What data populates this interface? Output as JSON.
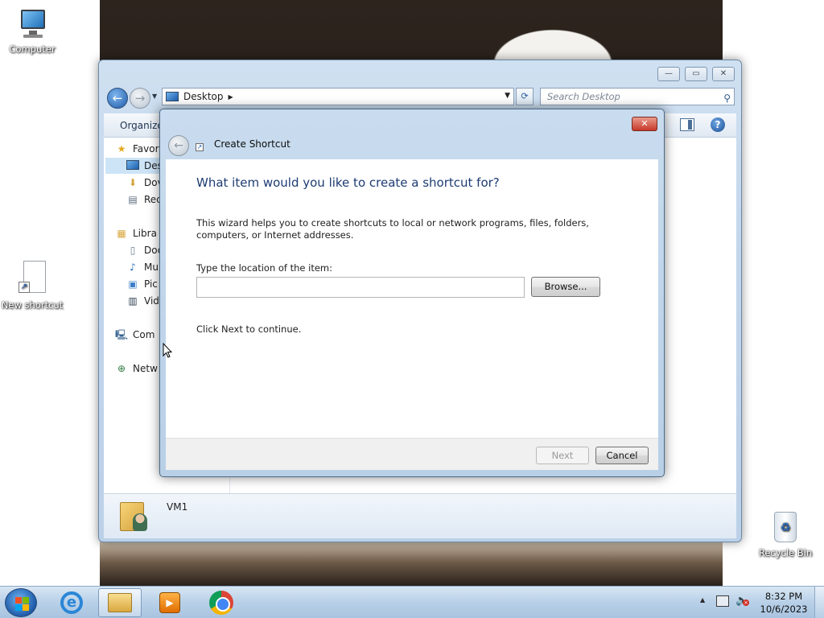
{
  "desktop": {
    "icons": [
      {
        "label": "Computer"
      },
      {
        "label": "New shortcut"
      },
      {
        "label": "Recycle Bin"
      }
    ]
  },
  "explorer": {
    "address": "Desktop",
    "search_placeholder": "Search Desktop",
    "command_bar": {
      "organize": "Organize"
    },
    "nav_items": [
      {
        "label": "Favor",
        "icon": "star-icon",
        "selected": false
      },
      {
        "label": "Des",
        "icon": "desktop-icon",
        "selected": true
      },
      {
        "label": "Dov",
        "icon": "downloads-icon",
        "selected": false
      },
      {
        "label": "Rec",
        "icon": "recent-icon",
        "selected": false
      },
      {
        "label": "Libra",
        "icon": "libraries-icon",
        "selected": false
      },
      {
        "label": "Doc",
        "icon": "documents-icon",
        "selected": false
      },
      {
        "label": "Mu",
        "icon": "music-icon",
        "selected": false
      },
      {
        "label": "Pic",
        "icon": "pictures-icon",
        "selected": false
      },
      {
        "label": "Vid",
        "icon": "videos-icon",
        "selected": false
      },
      {
        "label": "Com",
        "icon": "computer-icon",
        "selected": false
      },
      {
        "label": "Netw",
        "icon": "network-icon",
        "selected": false
      }
    ],
    "details": {
      "name": "VM1"
    },
    "window_controls": {
      "minimize": "—",
      "maximize": "▭",
      "close": "✕"
    }
  },
  "wizard": {
    "title": "Create Shortcut",
    "heading": "What item would you like to create a shortcut for?",
    "description": "This wizard helps you to create shortcuts to local or network programs, files, folders, computers, or Internet addresses.",
    "location_label": "Type the location of the item:",
    "location_value": "",
    "browse_label": "Browse...",
    "continue_text": "Click Next to continue.",
    "next_label": "Next",
    "cancel_label": "Cancel",
    "next_enabled": false
  },
  "taskbar": {
    "items": [
      {
        "name": "internet-explorer",
        "active": false
      },
      {
        "name": "windows-explorer",
        "active": true
      },
      {
        "name": "media-player",
        "active": false
      },
      {
        "name": "chrome",
        "active": false
      }
    ],
    "clock": {
      "time": "8:32 PM",
      "date": "10/6/2023"
    }
  },
  "colors": {
    "heading_blue": "#1d3b73",
    "selection": "#cde4f7",
    "close_red": "#c6392a"
  }
}
